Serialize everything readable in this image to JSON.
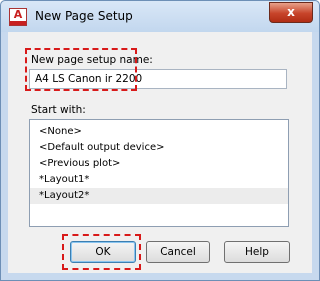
{
  "window": {
    "title": "New Page Setup",
    "app_icon": "autocad-icon",
    "close_glyph": "x"
  },
  "name_section": {
    "label": "New page setup name:",
    "value": "A4 LS Canon ir 2200"
  },
  "start_section": {
    "label": "Start with:",
    "items": [
      {
        "label": "<None>",
        "selected": false
      },
      {
        "label": "<Default output device>",
        "selected": false
      },
      {
        "label": "<Previous plot>",
        "selected": false
      },
      {
        "label": "*Layout1*",
        "selected": false
      },
      {
        "label": "*Layout2*",
        "selected": true
      }
    ]
  },
  "buttons": {
    "ok": "OK",
    "cancel": "Cancel",
    "help": "Help"
  },
  "colors": {
    "highlight_annotation": "#d81a1a",
    "title_bar": "#c7d9ee",
    "close_button": "#c7442a"
  }
}
